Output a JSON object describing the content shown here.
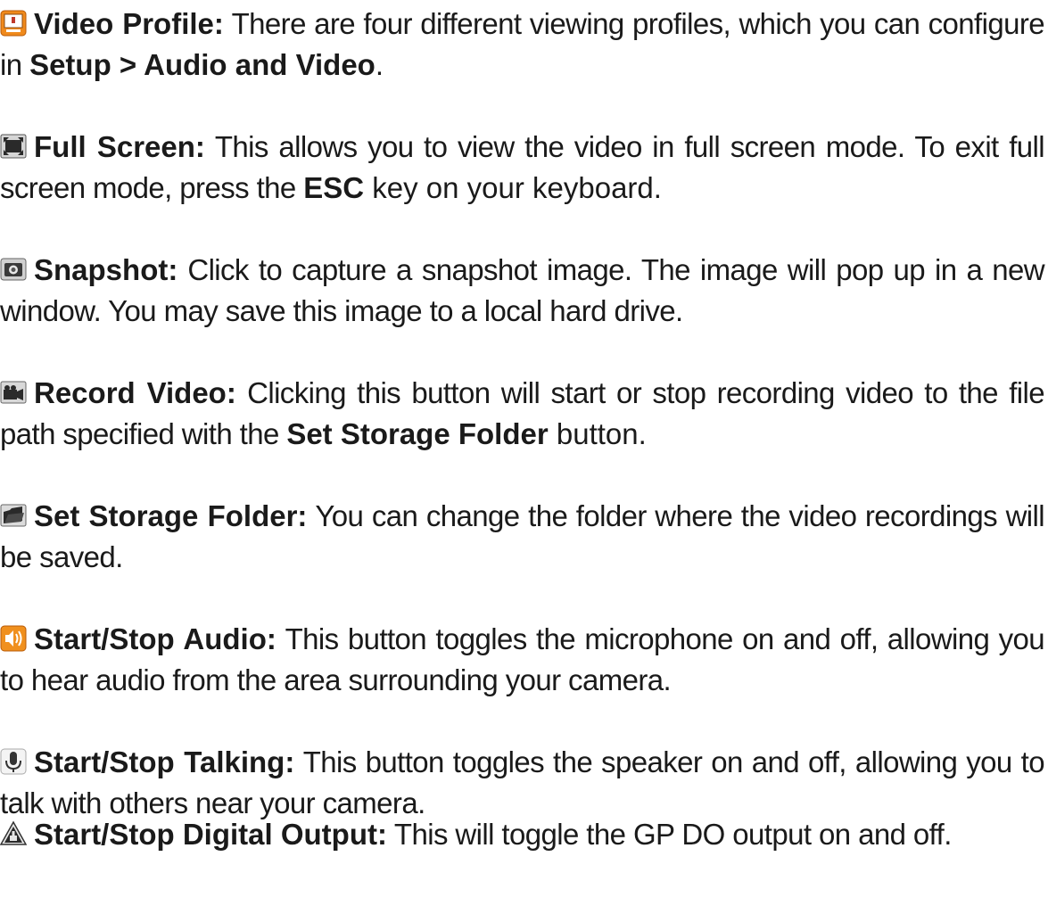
{
  "entries": [
    {
      "icon": "video-profile-icon",
      "term": "Video Profile:",
      "text_a": " There are four different viewing profiles, which you can configure in ",
      "bold_a": "Setup > Audio and Video",
      "text_b": "."
    },
    {
      "icon": "full-screen-icon",
      "term": "Full Screen:",
      "text_a": " This allows you to view the video in full screen mode. To exit full screen mode, press the ",
      "bold_a": "ESC",
      "text_b": " key on your keyboard."
    },
    {
      "icon": "snapshot-icon",
      "term": "Snapshot:",
      "text_a": " Click to capture a snapshot image. The image will pop up in a new window. You may save this image to a local hard drive."
    },
    {
      "icon": "record-video-icon",
      "term": "Record Video:",
      "text_a": " Clicking this button will start or stop recording video to the file path specified with the ",
      "bold_a": "Set Storage Folder",
      "text_b": " button."
    },
    {
      "icon": "folder-icon",
      "term": "Set Storage Folder:",
      "text_a": " You can change the folder where the video recordings will be saved."
    },
    {
      "icon": "speaker-icon",
      "term": "Start/Stop Audio:",
      "text_a": " This button toggles the microphone on and off, allowing you to hear audio from the area surrounding your camera."
    },
    {
      "icon": "microphone-icon",
      "term": "Start/Stop Talking:",
      "text_a": " This button toggles the speaker on and off, allowing you to talk with others near your camera."
    },
    {
      "icon": "digital-output-icon",
      "term": "Start/Stop Digital Output:",
      "text_a": "  This will toggle the GP DO output on and off."
    }
  ]
}
